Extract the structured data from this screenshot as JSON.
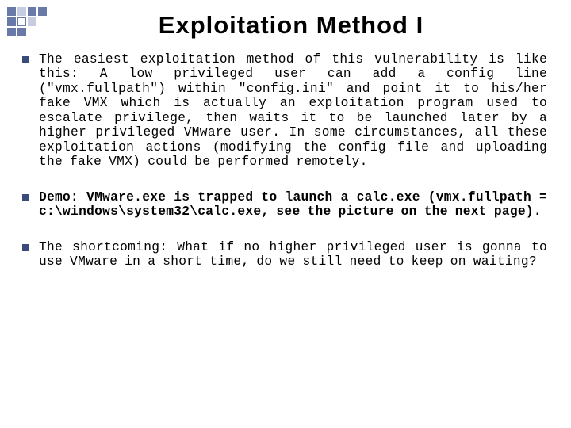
{
  "title": "Exploitation Method I",
  "bullets": [
    {
      "text": "The easiest exploitation method of this vulnerability is like this: A low privileged user can add a config line (\"vmx.fullpath\") within  \"config.ini\" and point it to his/her fake VMX which is actually an exploitation program used to escalate privilege, then waits it to be launched later by a higher privileged VMware user. In some circumstances, all these exploitation actions (modifying the config file and uploading the fake VMX) could be performed remotely.",
      "bold": false
    },
    {
      "text": "Demo: VMware.exe is trapped to launch a calc.exe (vmx.fullpath = c:\\windows\\system32\\calc.exe, see the picture on the next page).",
      "bold": true
    },
    {
      "text": "The shortcoming: What if no higher privileged user is gonna to use VMware in a short time, do we still need to keep on waiting?",
      "bold": false
    }
  ]
}
